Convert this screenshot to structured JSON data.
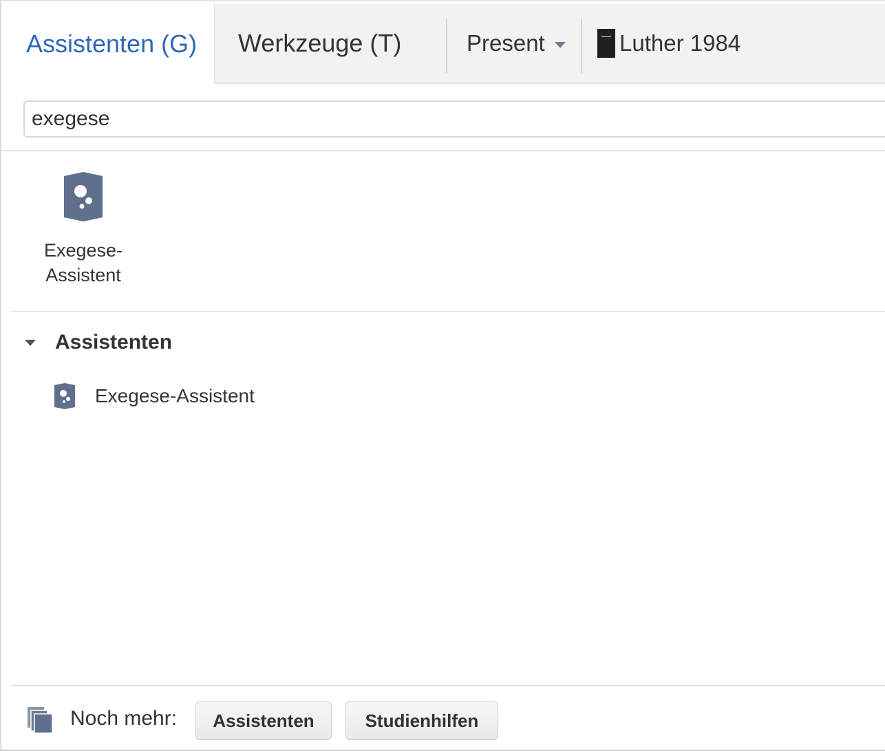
{
  "tabs": {
    "guides": "Assistenten (G)",
    "tools": "Werkzeuge (T)",
    "present": "Present",
    "resource": "Luther 1984"
  },
  "search": {
    "value": "exegese"
  },
  "tiles": [
    {
      "label_line1": "Exegese-",
      "label_line2": "Assistent",
      "icon": "exegesis-guide-icon"
    }
  ],
  "groups": [
    {
      "title": "Assistenten",
      "items": [
        {
          "label": "Exegese-Assistent",
          "icon": "exegesis-guide-icon"
        }
      ]
    }
  ],
  "footer": {
    "label": "Noch mehr:",
    "buttons": [
      "Assistenten",
      "Studienhilfen"
    ]
  },
  "colors": {
    "active_tab": "#2f67b8",
    "icon_slate": "#5f6f8c"
  }
}
